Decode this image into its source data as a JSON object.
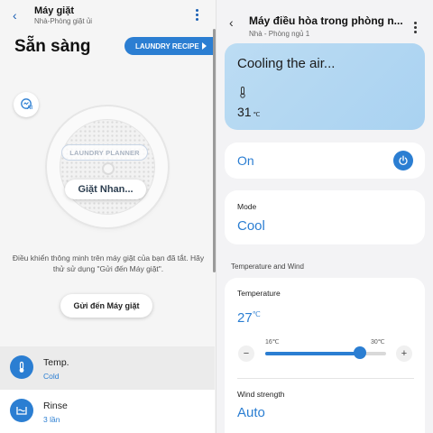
{
  "washer": {
    "header": {
      "title": "Máy giặt",
      "subtitle": "Nhà-Phòng giặt ủi"
    },
    "status": "Sẵn sàng",
    "recipe_button": "LAUNDRY RECIPE",
    "ai_badge": "AI",
    "planner_label": "LAUNDRY PLANNER",
    "program": "Giặt Nhan...",
    "notice": "Điều khiển thông minh trên máy giặt của bạn đã tắt. Hãy thử sử dụng \"Gửi đến Máy giặt\".",
    "send_button": "Gửi đến Máy giặt",
    "options": [
      {
        "label": "Temp.",
        "value": "Cold",
        "icon": "thermometer-icon"
      },
      {
        "label": "Rinse",
        "value": "3 lần",
        "icon": "rinse-icon"
      }
    ]
  },
  "ac": {
    "header": {
      "title": "Máy điều hòa trong phòng n...",
      "subtitle": "Nhà - Phòng ngủ 1"
    },
    "status_text": "Cooling the air...",
    "current_temp": "31",
    "current_temp_unit": "℃",
    "power_label": "On",
    "mode_label": "Mode",
    "mode_value": "Cool",
    "section_title": "Temperature and Wind",
    "temperature": {
      "label": "Temperature",
      "value": "27",
      "unit": "℃",
      "min_label": "16℃",
      "max_label": "30℃",
      "min": 16,
      "max": 30,
      "current": 27
    },
    "wind_label": "Wind strength",
    "wind_value": "Auto"
  },
  "colors": {
    "accent": "#2b7ed2",
    "status_card": "#b3d7f2"
  }
}
